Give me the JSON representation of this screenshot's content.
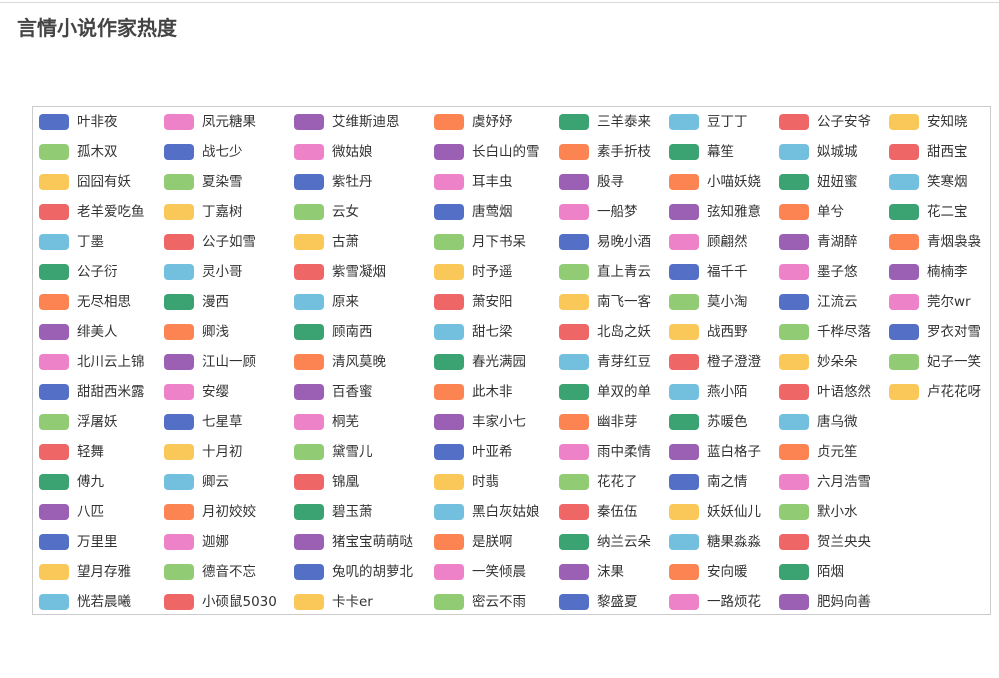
{
  "chart_data": {
    "type": "legend",
    "title": "言情小说作家热度",
    "palette": [
      "#5470c6",
      "#ee82c9",
      "#9b5fb4",
      "#fc8452",
      "#3ba272",
      "#73c0de",
      "#ee6666",
      "#fac858",
      "#91cc75"
    ],
    "columns": [
      [
        "叶非夜",
        "孤木双",
        "囧囧有妖",
        "老羊爱吃鱼",
        "丁墨",
        "公子衍",
        "无尽相思",
        "绯美人",
        "北川云上锦",
        "甜甜西米露",
        "浮屠妖",
        "轻舞",
        "傅九",
        "八匹",
        "万里里",
        "望月存雅",
        "恍若晨曦"
      ],
      [
        "凤元糖果",
        "战七少",
        "夏染雪",
        "丁嘉树",
        "公子如雪",
        "灵小哥",
        "漫西",
        "卿浅",
        "江山一顾",
        "安缨",
        "七星草",
        "十月初",
        "卿云",
        "月初姣姣",
        "迦娜",
        "德音不忘",
        "小硕鼠5030"
      ],
      [
        "艾维斯迪恩",
        "微姑娘",
        "紫牡丹",
        "云女",
        "古萧",
        "紫雪凝烟",
        "原来",
        "顾南西",
        "清风莫晚",
        "百香蜜",
        "桐芜",
        "黛雪儿",
        "锦凰",
        "碧玉萧",
        "猪宝宝萌萌哒",
        "兔叽的胡萝北",
        "卡卡er"
      ],
      [
        "虞妤妤",
        "长白山的雪",
        "耳丰虫",
        "唐莺烟",
        "月下书呆",
        "时予遥",
        "萧安阳",
        "甜七梁",
        "春光满园",
        "此木非",
        "丰家小七",
        "叶亚希",
        "时翡",
        "黑白灰姑娘",
        "是朕啊",
        "一笑倾晨",
        "密云不雨"
      ],
      [
        "三羊泰来",
        "素手折枝",
        "殷寻",
        "一船梦",
        "易晚小酒",
        "直上青云",
        "南飞一客",
        "北岛之妖",
        "青芽红豆",
        "单双的单",
        "幽非芽",
        "雨中柔情",
        "花花了",
        "秦伍伍",
        "纳兰云朵",
        "沫果",
        "黎盛夏"
      ],
      [
        "豆丁丁",
        "幕笙",
        "小喵妖娆",
        "弦知雅意",
        "顾翩然",
        "福千千",
        "莫小淘",
        "战西野",
        "橙子澄澄",
        "燕小陌",
        "苏暖色",
        "蓝白格子",
        "南之情",
        "妖妖仙儿",
        "糖果淼淼",
        "安向暖",
        "一路烦花"
      ],
      [
        "公子安爷",
        "姒城城",
        "妞妞蜜",
        "单兮",
        "青湖醉",
        "墨子悠",
        "江流云",
        "千桦尽落",
        "妙朵朵",
        "叶语悠然",
        "唐乌微",
        "贞元笙",
        "六月浩雪",
        "默小水",
        "贺兰央央",
        "陌烟",
        "肥妈向善"
      ],
      [
        "安知晓",
        "甜西宝",
        "笑寒烟",
        "花二宝",
        "青烟袅袅",
        "楠楠李",
        "莞尔wr",
        "罗衣对雪",
        "妃子一笑",
        "卢花花呀"
      ]
    ]
  }
}
